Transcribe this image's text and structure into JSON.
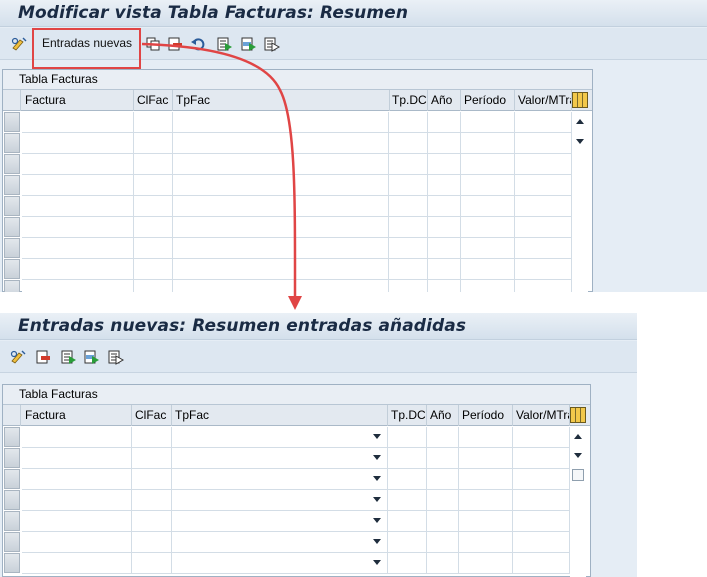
{
  "top": {
    "title": "Modificar vista Tabla Facturas: Resumen",
    "toolbar_text": "Entradas nuevas",
    "table_caption": "Tabla Facturas",
    "columns": [
      "Factura",
      "ClFac",
      "TpFac",
      "Tp.DC",
      "Año",
      "Período",
      "Valor/MTra"
    ]
  },
  "bottom": {
    "title": "Entradas nuevas: Resumen entradas añadidas",
    "table_caption": "Tabla Facturas",
    "columns": [
      "Factura",
      "ClFac",
      "TpFac",
      "Tp.DC",
      "Año",
      "Período",
      "Valor/MTra"
    ]
  },
  "annotation": {
    "highlight_color": "#e04545",
    "arrow_color": "#e04545"
  },
  "icons": [
    "display-change-icon",
    "copy-icon",
    "delete-icon",
    "undo-icon",
    "select-all-icon",
    "select-block-icon",
    "deselect-all-icon",
    "column-config-icon"
  ]
}
